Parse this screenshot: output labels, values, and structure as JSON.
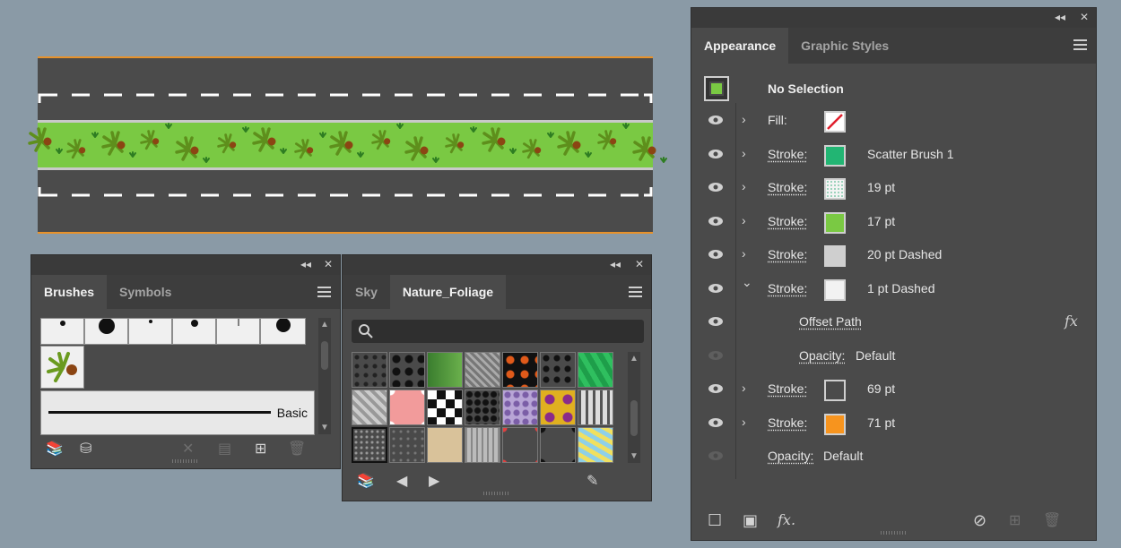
{
  "colors": {
    "canvas_bg": "#8a9aa6",
    "road": "#4b4b4b",
    "road_edge": "#e8922a",
    "median": "#7ac943",
    "panel": "#4a4a4a",
    "accent_orange": "#f7941e",
    "accent_teal": "#22b573"
  },
  "brushes_panel": {
    "tabs": [
      "Brushes",
      "Symbols"
    ],
    "active_tab": "Brushes",
    "collapse_icon": "double-chevron-left-icon",
    "close_icon": "close-icon",
    "basic_label": "Basic",
    "footer_icons": [
      "library-icon",
      "cc-library-icon",
      "remove-brush-icon",
      "options-icon",
      "new-brush-icon",
      "delete-icon"
    ]
  },
  "swatch_panel": {
    "tabs": [
      "Sky",
      "Nature_Foliage"
    ],
    "active_tab": "Nature_Foliage",
    "search_icon": "search-icon",
    "footer_icons": [
      "library-icon",
      "prev-icon",
      "next-icon",
      "pin-icon"
    ]
  },
  "appearance_panel": {
    "tabs": [
      "Appearance",
      "Graphic Styles"
    ],
    "active_tab": "Appearance",
    "header": "No Selection",
    "rows": [
      {
        "label": "Fill:",
        "value": "",
        "chip": "none",
        "expanded": false,
        "underline": false
      },
      {
        "label": "Stroke:",
        "value": "Scatter Brush 1",
        "chip": "#22b573",
        "expanded": false,
        "underline": true
      },
      {
        "label": "Stroke:",
        "value": "19 pt",
        "chip": "dotted",
        "expanded": false,
        "underline": true
      },
      {
        "label": "Stroke:",
        "value": "17 pt",
        "chip": "#7ac943",
        "expanded": false,
        "underline": true
      },
      {
        "label": "Stroke:",
        "value": "20 pt Dashed",
        "chip": "#cfcfcf",
        "expanded": false,
        "underline": true
      },
      {
        "label": "Stroke:",
        "value": "1 pt Dashed",
        "chip": "#f2f2f2",
        "expanded": true,
        "underline": true
      },
      {
        "label": "Offset Path",
        "value": "",
        "sub": true,
        "fx": true
      },
      {
        "label": "Opacity:",
        "value": "Default",
        "sub": true,
        "dim_eye": true
      },
      {
        "label": "Stroke:",
        "value": "69 pt",
        "chip": "#4b4b4b",
        "expanded": false,
        "underline": true
      },
      {
        "label": "Stroke:",
        "value": "71 pt",
        "chip": "#f7941e",
        "expanded": false,
        "underline": true
      },
      {
        "label": "Opacity:",
        "value": "Default",
        "dim_eye": true,
        "no_chev": true
      }
    ],
    "fx_label": "fx",
    "footer_fx": "fx.",
    "footer_icons": [
      "add-stroke-icon",
      "add-fill-icon",
      "fx-menu-icon",
      "clear-appearance-icon",
      "duplicate-item-icon",
      "delete-item-icon"
    ]
  }
}
